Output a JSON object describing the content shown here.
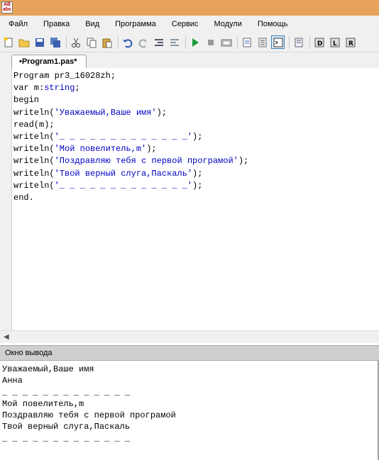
{
  "window": {
    "icon_text": "AB abc"
  },
  "menu": [
    "Файл",
    "Правка",
    "Вид",
    "Программа",
    "Сервис",
    "Модули",
    "Помощь"
  ],
  "toolbar": {
    "icons": [
      "new-file-icon",
      "open-file-icon",
      "save-icon",
      "save-all-icon",
      "cut-icon",
      "copy-icon",
      "paste-icon",
      "undo-icon",
      "redo-icon",
      "unindent-icon",
      "indent-icon",
      "run-icon",
      "stop-icon",
      "compile-icon",
      "step-into-icon",
      "step-over-icon",
      "output-window-icon",
      "properties-icon",
      "module-d-icon",
      "module-l-icon",
      "module-r-icon"
    ]
  },
  "tab": {
    "label": "•Program1.pas*"
  },
  "editor": {
    "lines": [
      "Program pr3_16028zh;",
      "var m:string;",
      "begin",
      "writeln('Уважаемый,Ваше имя');",
      "read(m);",
      "writeln('_ _ _ _ _ _ _ _ _ _ _ _ _');",
      "writeln('Мой повелитель,m');",
      "writeln('Поздравляю тебя с первой програмой');",
      "writeln('Твой верный слуга,Паскаль');",
      "writeln('_ _ _ _ _ _ _ _ _ _ _ _ _');",
      "end."
    ]
  },
  "output": {
    "title": "Окно вывода",
    "lines": [
      "Уважаемый,Ваше имя",
      "Анна",
      "_ _ _ _ _ _ _ _ _ _ _ _ _",
      "Мой повелитель,m",
      "Поздравляю тебя с первой програмой",
      "Твой верный слуга,Паскаль",
      "_ _ _ _ _ _ _ _ _ _ _ _ _"
    ]
  },
  "colors": {
    "titlebar": "#e8a35a",
    "string": "#0000c0",
    "chrome": "#f0f0f0"
  }
}
